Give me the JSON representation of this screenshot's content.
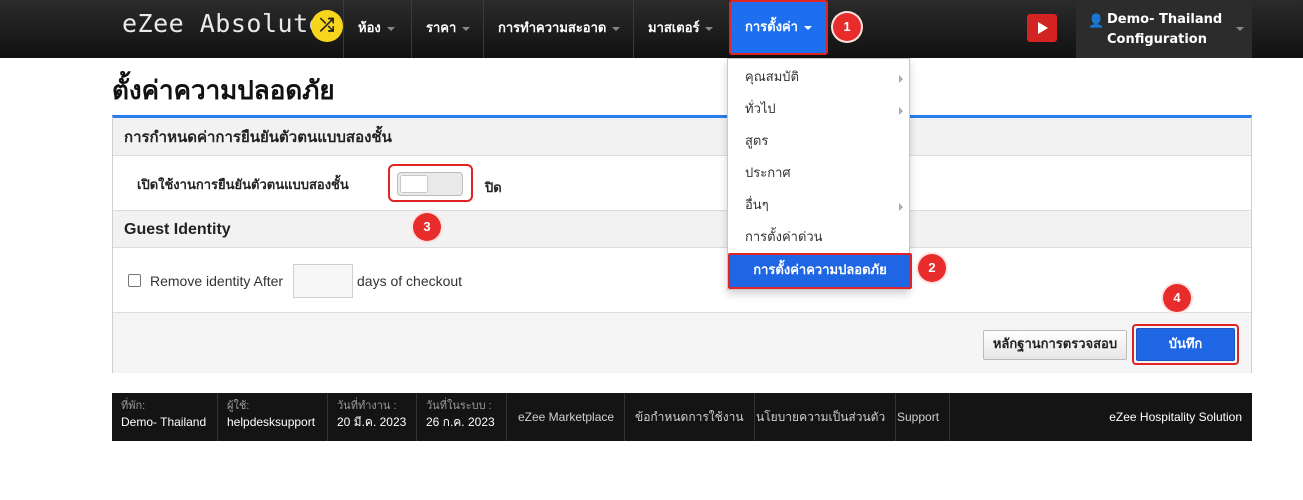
{
  "navbar": {
    "brand": "eZee Absolute",
    "brand_icon": "shuffle-icon",
    "items": [
      {
        "label": "ห้อง"
      },
      {
        "label": "ราคา"
      },
      {
        "label": "การทำความสะอาด"
      },
      {
        "label": "มาสเตอร์"
      },
      {
        "label": "การตั้งค่า"
      }
    ],
    "youtube_icon": "youtube-icon",
    "user": {
      "line1": "Demo- Thailand",
      "line2": "Configuration",
      "icon": "user-icon"
    }
  },
  "markers": [
    "1",
    "2",
    "3",
    "4"
  ],
  "page": {
    "title": "ตั้งค่าความปลอดภัย"
  },
  "two_factor": {
    "header": "การกำหนดค่าการยืนยันตัวตนแบบสองชั้น",
    "label": "เปิดใช้งานการยืนยันตัวตนแบบสองชั้น",
    "state": "ปิด",
    "enabled": false
  },
  "guest_identity": {
    "header": "Guest Identity",
    "checkbox_label": "Remove identity After",
    "days_value": "",
    "suffix": "days of checkout"
  },
  "buttons": {
    "audit": "หลักฐานการตรวจสอบ",
    "save": "บันทึก"
  },
  "dropdown": {
    "items": [
      {
        "label": "คุณสมบัติ",
        "has_sub": true
      },
      {
        "label": "ทั่วไป",
        "has_sub": true
      },
      {
        "label": "สูตร",
        "has_sub": false
      },
      {
        "label": "ประกาศ",
        "has_sub": false
      },
      {
        "label": "อื่นๆ",
        "has_sub": true
      },
      {
        "label": "การตั้งค่าด่วน",
        "has_sub": false
      }
    ],
    "highlighted": "การตั้งค่าความปลอดภัย"
  },
  "footer": {
    "property_label": "ที่พัก:",
    "property_value": "Demo- Thailand",
    "user_label": "ผู้ใช้:",
    "user_value": "helpdesksupport",
    "workdate_label": "วันที่ทำงาน :",
    "workdate_value": "20 มี.ค. 2023",
    "sysdate_label": "วันที่ในระบบ :",
    "sysdate_value": "26 ก.ค. 2023",
    "links": [
      "eZee Marketplace",
      "ข้อกำหนดการใช้งาน",
      "นโยบายความเป็นส่วนตัว",
      "Support"
    ],
    "brand": "eZee Hospitality Solution"
  },
  "colors": {
    "accent": "#1f66e5",
    "highlight_border": "#e02424",
    "marker": "#e82c2c",
    "navbar": "#111111"
  }
}
